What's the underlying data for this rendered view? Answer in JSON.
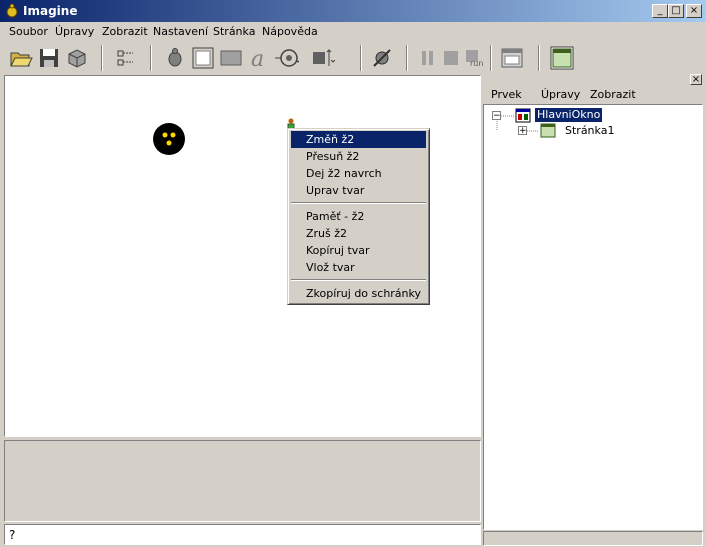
{
  "window": {
    "title": "Imagine",
    "app_icon": "turtle-icon",
    "controls": {
      "minimize": "_",
      "maximize": "□",
      "close": "×"
    }
  },
  "menu": [
    "Soubor",
    "Úpravy",
    "Zobrazit",
    "Nastavení",
    "Stránka",
    "Nápověda"
  ],
  "toolbar": {
    "buttons": [
      "open-folder-icon",
      "save-icon",
      "package-icon",
      "tree-list-icon",
      "turtle-new-icon",
      "button-icon",
      "panel-icon",
      "text-icon",
      "slider-icon",
      "scrollbar-icon",
      "run-gear-icon",
      "pause-icon",
      "stop-icon",
      "run-icon",
      "window-icon",
      "page-icon"
    ],
    "run_label": "run"
  },
  "context_menu": {
    "items": [
      "Změň ž2",
      "Přesuň ž2",
      "Dej ž2 navrch",
      "Uprav tvar",
      "Paměť - ž2",
      "Zruš ž2",
      "Kopíruj tvar",
      "Vlož tvar",
      "Zkopíruj do schránky"
    ],
    "selected_index": 0
  },
  "command_line": {
    "text": "?"
  },
  "right_pane": {
    "menu": [
      "Prvek",
      "Úpravy",
      "Zobrazit"
    ],
    "tree": [
      {
        "label": "HlavniOkno",
        "expanded": true,
        "selected": true
      },
      {
        "label": "Stránka1",
        "expanded": false,
        "selected": false
      }
    ],
    "close": "×"
  },
  "colors": {
    "titlebar_start": "#0a246a",
    "titlebar_end": "#a6caf0",
    "selection": "#0a246a",
    "face": "#d4d0c8",
    "turtle_eyes": "#ffd700"
  }
}
